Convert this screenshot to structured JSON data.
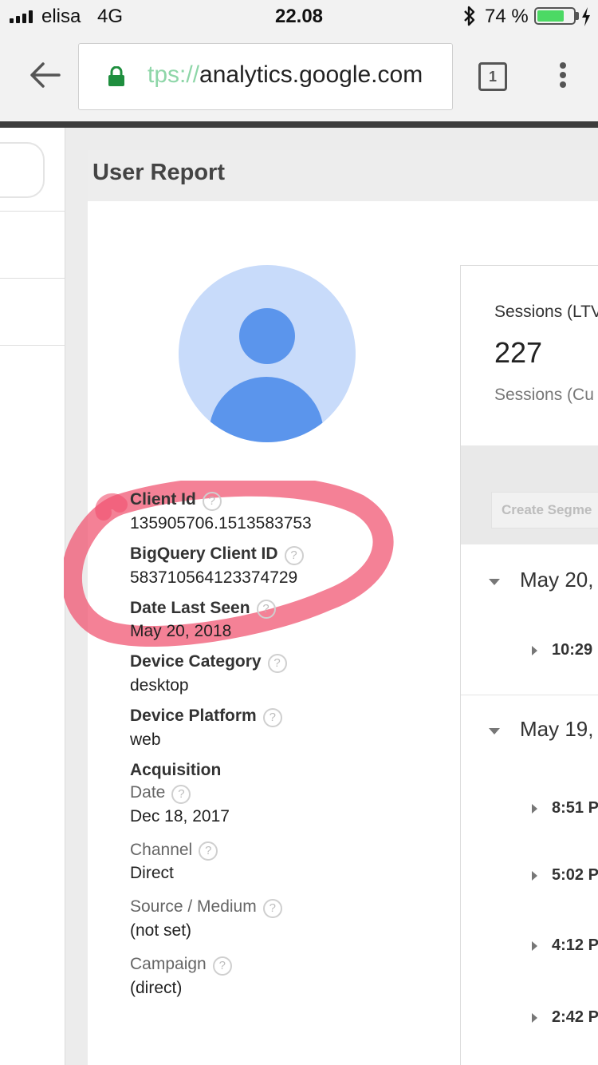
{
  "status_bar": {
    "carrier": "elisa",
    "network": "4G",
    "time": "22.08",
    "battery_percent": "74 %",
    "battery_level": 0.74
  },
  "browser": {
    "url_scheme_fragment": "tps://",
    "url_host": "analytics.google.com",
    "tab_count": "1"
  },
  "report": {
    "title": "User Report"
  },
  "details": {
    "client_id_label": "Client Id",
    "client_id_value": "135905706.1513583753",
    "bigquery_label": "BigQuery Client ID",
    "bigquery_value": "583710564123374729",
    "last_seen_label": "Date Last Seen",
    "last_seen_value": "May 20, 2018",
    "device_category_label": "Device Category",
    "device_category_value": "desktop",
    "device_platform_label": "Device Platform",
    "device_platform_value": "web",
    "acquisition_label": "Acquisition",
    "date_label": "Date",
    "date_value": "Dec 18, 2017",
    "channel_label": "Channel",
    "channel_value": "Direct",
    "source_label": "Source / Medium",
    "source_value": "(not set)",
    "campaign_label": "Campaign",
    "campaign_value": "(direct)",
    "help_glyph": "?"
  },
  "summary": {
    "sessions_label": "Sessions (LTV",
    "sessions_value": "227",
    "sessions_sub": "Sessions (Cu",
    "create_segment": "Create Segme"
  },
  "activity": {
    "days": [
      {
        "date": "May 20,",
        "sessions": [
          "10:29"
        ]
      },
      {
        "date": "May 19,",
        "sessions": [
          "8:51 P",
          "5:02 P",
          "4:12 P",
          "2:42 P"
        ]
      }
    ]
  },
  "colors": {
    "avatar_bg": "#c8dbfa",
    "avatar_fg": "#5b95ec",
    "highlight": "#f0506e",
    "lock": "#1e8e3e",
    "battery": "#4cd964"
  }
}
